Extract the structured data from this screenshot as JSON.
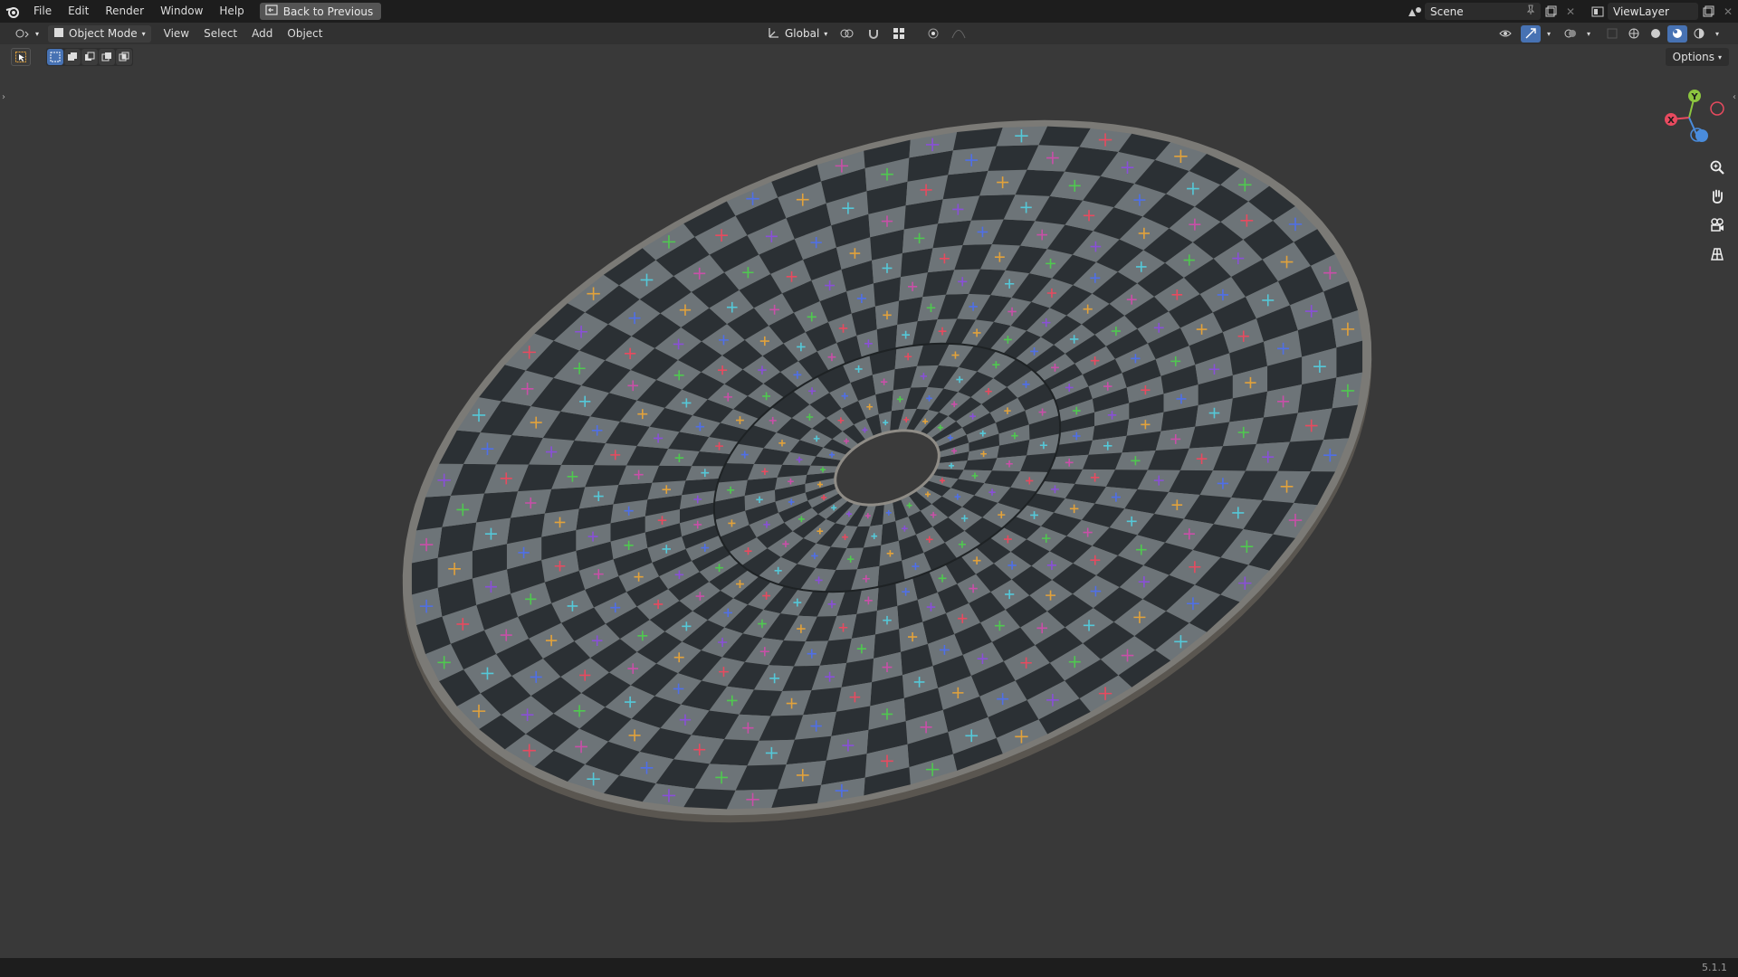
{
  "topbar": {
    "menus": [
      "File",
      "Edit",
      "Render",
      "Window",
      "Help"
    ],
    "back_label": "Back to Previous",
    "scene_label": "Scene",
    "viewlayer_label": "ViewLayer"
  },
  "header": {
    "mode_label": "Object Mode",
    "menus": [
      "View",
      "Select",
      "Add",
      "Object"
    ],
    "transform_orientation": "Global",
    "options_label": "Options"
  },
  "gizmo": {
    "y_label": "Y",
    "x_label": "X"
  },
  "status": {
    "version": "5.1.1"
  },
  "colors": {
    "accent": "#4772b3",
    "checker_dark": "#2b3034",
    "checker_light": "#6d7478",
    "axis_x": "#e84a5f",
    "axis_y": "#8cc63f",
    "axis_z": "#4a8cdc"
  },
  "icons": {
    "blender": "blender-logo-icon",
    "back": "back-arrow-icon",
    "zoom": "zoom-icon",
    "pan": "hand-icon",
    "camera": "camera-icon",
    "grid": "grid-icon"
  }
}
